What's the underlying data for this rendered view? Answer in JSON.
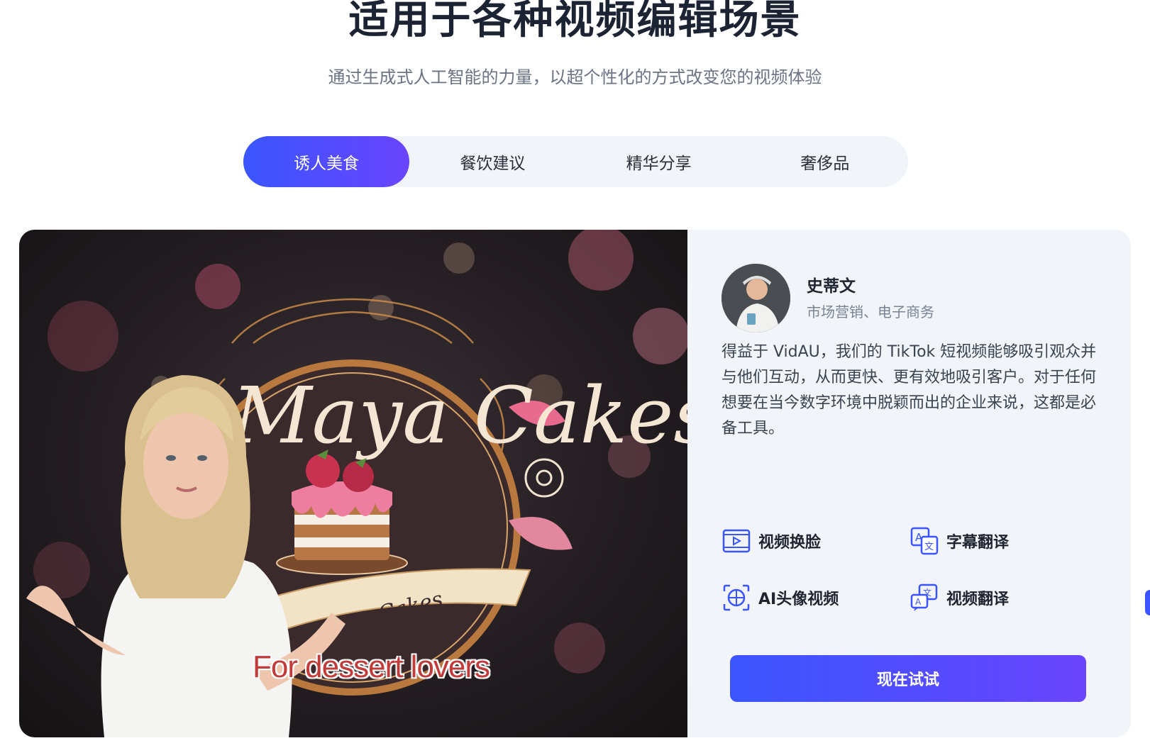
{
  "header": {
    "title": "适用于各种视频编辑场景",
    "subtitle": "通过生成式人工智能的力量，以超个性化的方式改变您的视频体验"
  },
  "tabs": [
    {
      "label": "诱人美食",
      "active": true
    },
    {
      "label": "餐饮建议",
      "active": false
    },
    {
      "label": "精华分享",
      "active": false
    },
    {
      "label": "奢侈品",
      "active": false
    }
  ],
  "preview": {
    "logo_text": "Maya Cakes",
    "ribbon_text": "Cakes",
    "caption": "For dessert lovers"
  },
  "testimonial": {
    "name": "史蒂文",
    "role": "市场营销、电子商务",
    "quote": "得益于 VidAU，我们的 TikTok 短视频能够吸引观众并与他们互动，从而更快、更有效地吸引客户。对于任何想要在当今数字环境中脱颖而出的企业来说，这都是必备工具。"
  },
  "features": [
    {
      "label": "视频换脸",
      "icon": "video-face-swap-icon"
    },
    {
      "label": "字幕翻译",
      "icon": "subtitle-translate-icon"
    },
    {
      "label": "AI头像视频",
      "icon": "ai-avatar-video-icon"
    },
    {
      "label": "视频翻译",
      "icon": "video-translate-icon"
    }
  ],
  "cta": {
    "label": "现在试试"
  },
  "colors": {
    "accent_start": "#3a55ff",
    "accent_end": "#6a44ff",
    "card_bg": "#f1f4f8",
    "title": "#1c2333",
    "caption": "#c23b3b"
  }
}
